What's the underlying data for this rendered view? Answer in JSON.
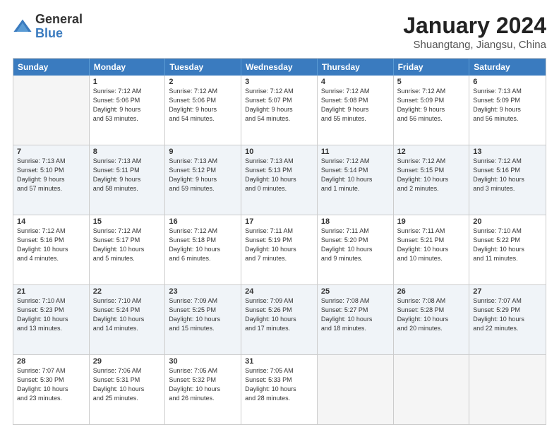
{
  "logo": {
    "general": "General",
    "blue": "Blue"
  },
  "title": {
    "month_year": "January 2024",
    "location": "Shuangtang, Jiangsu, China"
  },
  "days_of_week": [
    "Sunday",
    "Monday",
    "Tuesday",
    "Wednesday",
    "Thursday",
    "Friday",
    "Saturday"
  ],
  "weeks": [
    [
      {
        "day": "",
        "info": "",
        "empty": true
      },
      {
        "day": "1",
        "info": "Sunrise: 7:12 AM\nSunset: 5:06 PM\nDaylight: 9 hours\nand 53 minutes."
      },
      {
        "day": "2",
        "info": "Sunrise: 7:12 AM\nSunset: 5:06 PM\nDaylight: 9 hours\nand 54 minutes."
      },
      {
        "day": "3",
        "info": "Sunrise: 7:12 AM\nSunset: 5:07 PM\nDaylight: 9 hours\nand 54 minutes."
      },
      {
        "day": "4",
        "info": "Sunrise: 7:12 AM\nSunset: 5:08 PM\nDaylight: 9 hours\nand 55 minutes."
      },
      {
        "day": "5",
        "info": "Sunrise: 7:12 AM\nSunset: 5:09 PM\nDaylight: 9 hours\nand 56 minutes."
      },
      {
        "day": "6",
        "info": "Sunrise: 7:13 AM\nSunset: 5:09 PM\nDaylight: 9 hours\nand 56 minutes."
      }
    ],
    [
      {
        "day": "7",
        "info": "Sunrise: 7:13 AM\nSunset: 5:10 PM\nDaylight: 9 hours\nand 57 minutes."
      },
      {
        "day": "8",
        "info": "Sunrise: 7:13 AM\nSunset: 5:11 PM\nDaylight: 9 hours\nand 58 minutes."
      },
      {
        "day": "9",
        "info": "Sunrise: 7:13 AM\nSunset: 5:12 PM\nDaylight: 9 hours\nand 59 minutes."
      },
      {
        "day": "10",
        "info": "Sunrise: 7:13 AM\nSunset: 5:13 PM\nDaylight: 10 hours\nand 0 minutes."
      },
      {
        "day": "11",
        "info": "Sunrise: 7:12 AM\nSunset: 5:14 PM\nDaylight: 10 hours\nand 1 minute."
      },
      {
        "day": "12",
        "info": "Sunrise: 7:12 AM\nSunset: 5:15 PM\nDaylight: 10 hours\nand 2 minutes."
      },
      {
        "day": "13",
        "info": "Sunrise: 7:12 AM\nSunset: 5:16 PM\nDaylight: 10 hours\nand 3 minutes."
      }
    ],
    [
      {
        "day": "14",
        "info": "Sunrise: 7:12 AM\nSunset: 5:16 PM\nDaylight: 10 hours\nand 4 minutes."
      },
      {
        "day": "15",
        "info": "Sunrise: 7:12 AM\nSunset: 5:17 PM\nDaylight: 10 hours\nand 5 minutes."
      },
      {
        "day": "16",
        "info": "Sunrise: 7:12 AM\nSunset: 5:18 PM\nDaylight: 10 hours\nand 6 minutes."
      },
      {
        "day": "17",
        "info": "Sunrise: 7:11 AM\nSunset: 5:19 PM\nDaylight: 10 hours\nand 7 minutes."
      },
      {
        "day": "18",
        "info": "Sunrise: 7:11 AM\nSunset: 5:20 PM\nDaylight: 10 hours\nand 9 minutes."
      },
      {
        "day": "19",
        "info": "Sunrise: 7:11 AM\nSunset: 5:21 PM\nDaylight: 10 hours\nand 10 minutes."
      },
      {
        "day": "20",
        "info": "Sunrise: 7:10 AM\nSunset: 5:22 PM\nDaylight: 10 hours\nand 11 minutes."
      }
    ],
    [
      {
        "day": "21",
        "info": "Sunrise: 7:10 AM\nSunset: 5:23 PM\nDaylight: 10 hours\nand 13 minutes."
      },
      {
        "day": "22",
        "info": "Sunrise: 7:10 AM\nSunset: 5:24 PM\nDaylight: 10 hours\nand 14 minutes."
      },
      {
        "day": "23",
        "info": "Sunrise: 7:09 AM\nSunset: 5:25 PM\nDaylight: 10 hours\nand 15 minutes."
      },
      {
        "day": "24",
        "info": "Sunrise: 7:09 AM\nSunset: 5:26 PM\nDaylight: 10 hours\nand 17 minutes."
      },
      {
        "day": "25",
        "info": "Sunrise: 7:08 AM\nSunset: 5:27 PM\nDaylight: 10 hours\nand 18 minutes."
      },
      {
        "day": "26",
        "info": "Sunrise: 7:08 AM\nSunset: 5:28 PM\nDaylight: 10 hours\nand 20 minutes."
      },
      {
        "day": "27",
        "info": "Sunrise: 7:07 AM\nSunset: 5:29 PM\nDaylight: 10 hours\nand 22 minutes."
      }
    ],
    [
      {
        "day": "28",
        "info": "Sunrise: 7:07 AM\nSunset: 5:30 PM\nDaylight: 10 hours\nand 23 minutes."
      },
      {
        "day": "29",
        "info": "Sunrise: 7:06 AM\nSunset: 5:31 PM\nDaylight: 10 hours\nand 25 minutes."
      },
      {
        "day": "30",
        "info": "Sunrise: 7:05 AM\nSunset: 5:32 PM\nDaylight: 10 hours\nand 26 minutes."
      },
      {
        "day": "31",
        "info": "Sunrise: 7:05 AM\nSunset: 5:33 PM\nDaylight: 10 hours\nand 28 minutes."
      },
      {
        "day": "",
        "info": "",
        "empty": true
      },
      {
        "day": "",
        "info": "",
        "empty": true
      },
      {
        "day": "",
        "info": "",
        "empty": true
      }
    ]
  ]
}
